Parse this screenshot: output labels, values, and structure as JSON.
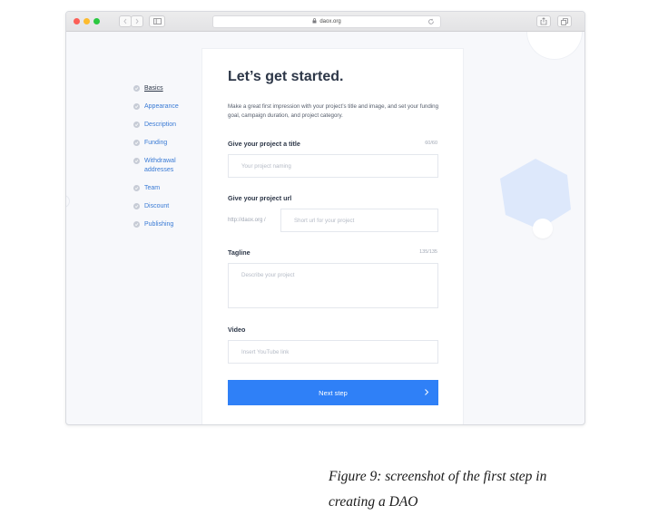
{
  "browser": {
    "url": "daox.org"
  },
  "sidebar": {
    "steps": [
      {
        "label": "Basics",
        "active": true
      },
      {
        "label": "Appearance"
      },
      {
        "label": "Description"
      },
      {
        "label": "Funding"
      },
      {
        "label": "Withdrawal addresses"
      },
      {
        "label": "Team"
      },
      {
        "label": "Discount"
      },
      {
        "label": "Publishing"
      }
    ]
  },
  "form": {
    "heading": "Let’s get started.",
    "intro": "Make a great first impression with your project’s title and image, and set your funding goal, campaign duration, and project category.",
    "title_label": "Give your project a title",
    "title_counter": "60/60",
    "title_placeholder": "Your project naming",
    "url_label": "Give your project url",
    "url_prefix": "http://daox.org /",
    "url_placeholder": "Short url for your project",
    "tagline_label": "Tagline",
    "tagline_counter": "135/135",
    "tagline_placeholder": "Describe your project",
    "video_label": "Video",
    "video_placeholder": "Insert YouTube link",
    "next_label": "Next step"
  },
  "caption": "Figure 9: screenshot of the first step in creating a DAO",
  "colors": {
    "accent": "#2f80f7",
    "link": "#3a7bd5",
    "hexagon": "#dde8fb"
  },
  "icons": [
    "back-icon",
    "forward-icon",
    "sidebar-toggle-icon",
    "lock-icon",
    "reload-icon",
    "share-icon",
    "tabs-icon",
    "check-icon",
    "chevron-right-icon"
  ]
}
